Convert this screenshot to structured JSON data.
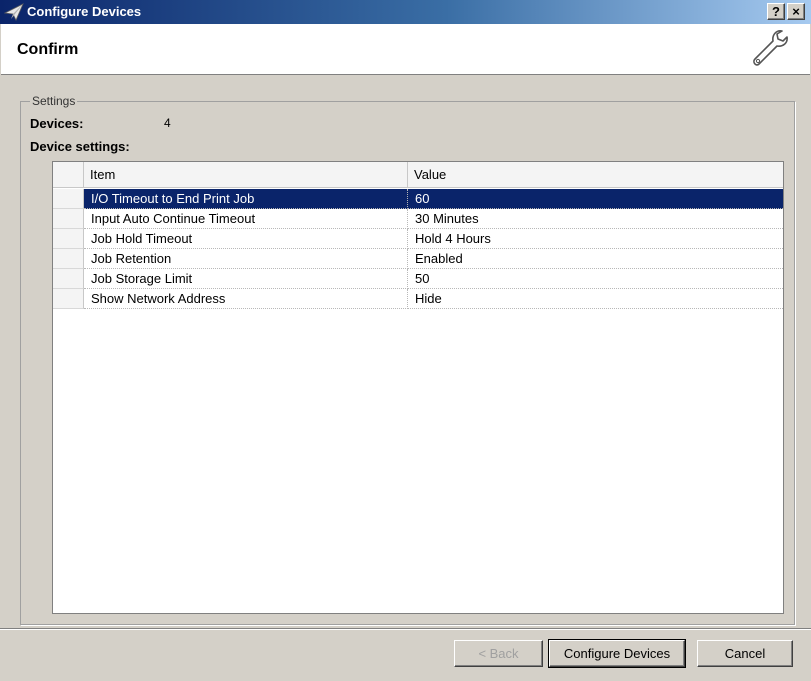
{
  "window": {
    "title": "Configure Devices",
    "help_label": "?",
    "close_label": "×"
  },
  "header": {
    "title": "Confirm"
  },
  "settings": {
    "group_label": "Settings",
    "devices_label": "Devices:",
    "devices_count": "4",
    "device_settings_label": "Device settings:"
  },
  "grid": {
    "columns": [
      "Item",
      "Value"
    ],
    "rows": [
      {
        "item": "I/O Timeout to End Print Job",
        "value": "60",
        "selected": true
      },
      {
        "item": "Input Auto Continue Timeout",
        "value": "30 Minutes"
      },
      {
        "item": "Job Hold Timeout",
        "value": "Hold 4 Hours"
      },
      {
        "item": "Job Retention",
        "value": "Enabled"
      },
      {
        "item": "Job Storage Limit",
        "value": "50"
      },
      {
        "item": "Show Network Address",
        "value": "Hide"
      }
    ]
  },
  "footer": {
    "back_label": "< Back",
    "configure_label": "Configure Devices",
    "cancel_label": "Cancel"
  },
  "icons": {
    "app": "paper-plane-icon",
    "header": "wrench-icon"
  },
  "colors": {
    "selection": "#0a246a",
    "titlebar": "#0a246a"
  }
}
